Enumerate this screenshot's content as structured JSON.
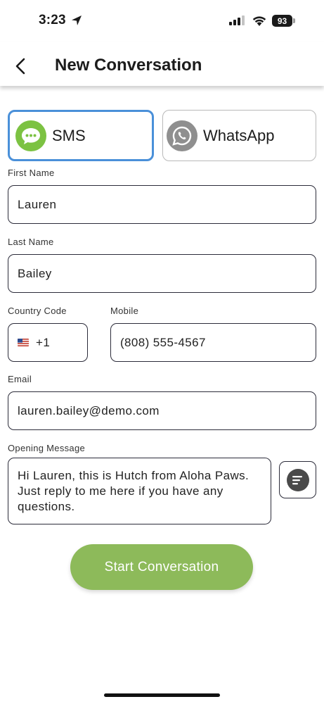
{
  "status_bar": {
    "time": "3:23",
    "battery": "93"
  },
  "header": {
    "title": "New Conversation"
  },
  "channels": [
    {
      "label": "SMS",
      "selected": true,
      "icon": "chat-bubble-icon"
    },
    {
      "label": "WhatsApp",
      "selected": false,
      "icon": "whatsapp-icon"
    }
  ],
  "form": {
    "first_name": {
      "label": "First Name",
      "value": "Lauren"
    },
    "last_name": {
      "label": "Last Name",
      "value": "Bailey"
    },
    "country_code": {
      "label": "Country Code",
      "value": "+1"
    },
    "mobile": {
      "label": "Mobile",
      "value": "(808) 555-4567"
    },
    "email": {
      "label": "Email",
      "value": "lauren.bailey@demo.com"
    },
    "opening_message": {
      "label": "Opening Message",
      "value": "Hi Lauren, this is Hutch from Aloha Paws. Just reply to me here if you have any questions."
    }
  },
  "cta": {
    "label": "Start Conversation"
  },
  "colors": {
    "accent_blue": "#4a90d9",
    "sms_green": "#7cc242",
    "cta_green": "#8dba5a"
  }
}
